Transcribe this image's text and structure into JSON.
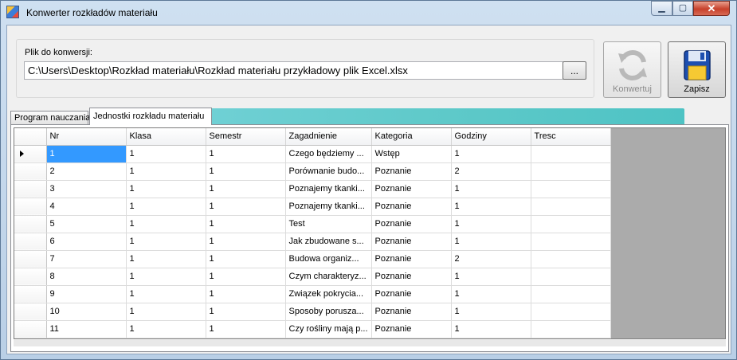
{
  "window": {
    "title": "Konwerter rozkładów materiału",
    "controls": {
      "minimize": "▁",
      "maximize": "▢",
      "close": "✕"
    }
  },
  "file": {
    "label": "Plik do konwersji:",
    "path": "C:\\Users\\Desktop\\Rozkład materiału\\Rozkład materiału przykładowy plik Excel.xlsx",
    "browse_label": "..."
  },
  "buttons": {
    "convert_label": "Konwertuj",
    "convert_enabled": false,
    "save_label": "Zapisz"
  },
  "tabs": [
    {
      "label": "Program nauczania",
      "active": false
    },
    {
      "label": "Jednostki rozkładu materiału",
      "active": true
    }
  ],
  "table": {
    "columns": [
      "Nr",
      "Klasa",
      "Semestr",
      "Zagadnienie",
      "Kategoria",
      "Godziny",
      "Tresc"
    ],
    "rows": [
      [
        "1",
        "1",
        "1",
        "Czego będziemy ...",
        "Wstęp",
        "1",
        ""
      ],
      [
        "2",
        "1",
        "1",
        "Porównanie budo...",
        "Poznanie",
        "2",
        ""
      ],
      [
        "3",
        "1",
        "1",
        "Poznajemy tkanki...",
        "Poznanie",
        "1",
        ""
      ],
      [
        "4",
        "1",
        "1",
        "Poznajemy tkanki...",
        "Poznanie",
        "1",
        ""
      ],
      [
        "5",
        "1",
        "1",
        "Test",
        "Poznanie",
        "1",
        ""
      ],
      [
        "6",
        "1",
        "1",
        "Jak zbudowane s...",
        "Poznanie",
        "1",
        ""
      ],
      [
        "7",
        "1",
        "1",
        "Budowa organiz...",
        "Poznanie",
        "2",
        ""
      ],
      [
        "8",
        "1",
        "1",
        "Czym charakteryz...",
        "Poznanie",
        "1",
        ""
      ],
      [
        "9",
        "1",
        "1",
        "Związek pokrycia...",
        "Poznanie",
        "1",
        ""
      ],
      [
        "10",
        "1",
        "1",
        "Sposoby porusza...",
        "Poznanie",
        "1",
        ""
      ],
      [
        "11",
        "1",
        "1",
        "Czy rośliny mają p...",
        "Poznanie",
        "1",
        ""
      ]
    ],
    "selected_row": 0,
    "selected_col": 0
  },
  "colors": {
    "selection": "#3399ff",
    "tab_accent": "#5ec9c9",
    "grid_empty": "#ababab"
  }
}
